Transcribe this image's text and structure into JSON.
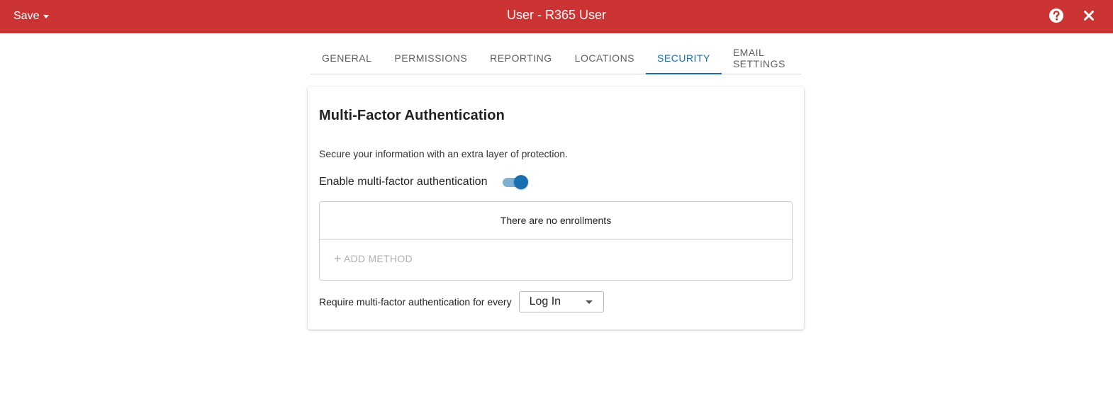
{
  "header": {
    "save_label": "Save",
    "title": "User - R365 User",
    "help_icon": "question-circle-icon",
    "close_icon": "close-icon",
    "bar_color": "#cc3333"
  },
  "tabs": [
    {
      "label": "GENERAL"
    },
    {
      "label": "PERMISSIONS"
    },
    {
      "label": "REPORTING"
    },
    {
      "label": "LOCATIONS"
    },
    {
      "label": "SECURITY",
      "active": true
    },
    {
      "label": "EMAIL SETTINGS"
    }
  ],
  "security": {
    "title": "Multi-Factor Authentication",
    "description": "Secure your information with an extra layer of protection.",
    "toggle_label": "Enable multi-factor authentication",
    "toggle_on": true,
    "empty_enrollments": "There are no enrollments",
    "add_method_label": "ADD METHOD",
    "require_label": "Require multi-factor authentication for every",
    "require_value": "Log In",
    "accent_color": "#1a6fb0"
  }
}
